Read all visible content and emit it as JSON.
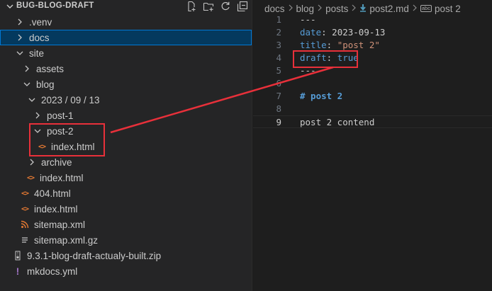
{
  "explorer": {
    "root_title": "BUG-BLOG-DRAFT",
    "tree": [
      {
        "label": ".venv",
        "type": "folder",
        "expanded": false,
        "depth": 1
      },
      {
        "label": "docs",
        "type": "folder",
        "expanded": false,
        "depth": 1,
        "selected": true
      },
      {
        "label": "site",
        "type": "folder",
        "expanded": true,
        "depth": 1
      },
      {
        "label": "assets",
        "type": "folder",
        "expanded": false,
        "depth": 2
      },
      {
        "label": "blog",
        "type": "folder",
        "expanded": true,
        "depth": 2
      },
      {
        "label": "2023 / 09 / 13",
        "type": "folder",
        "expanded": true,
        "depth": 3
      },
      {
        "label": "post-1",
        "type": "folder",
        "expanded": false,
        "depth": 4
      },
      {
        "label": "post-2",
        "type": "folder",
        "expanded": true,
        "depth": 4
      },
      {
        "label": "index.html",
        "type": "html",
        "depth": 5
      },
      {
        "label": "archive",
        "type": "folder",
        "expanded": false,
        "depth": 3
      },
      {
        "label": "index.html",
        "type": "html",
        "depth": 3
      },
      {
        "label": "404.html",
        "type": "html",
        "depth": 2
      },
      {
        "label": "index.html",
        "type": "html",
        "depth": 2
      },
      {
        "label": "sitemap.xml",
        "type": "rss",
        "depth": 2
      },
      {
        "label": "sitemap.xml.gz",
        "type": "gz",
        "depth": 2
      },
      {
        "label": "9.3.1-blog-draft-actualy-built.zip",
        "type": "zip",
        "depth": 1
      },
      {
        "label": "mkdocs.yml",
        "type": "yml",
        "depth": 1
      }
    ]
  },
  "editor": {
    "breadcrumb": {
      "part1": "docs",
      "part2": "blog",
      "part3": "posts",
      "file": "post2.md",
      "symbol": "post 2"
    },
    "lines": [
      {
        "n": "1",
        "text": "---"
      },
      {
        "n": "2",
        "key": "date",
        "value": "2023-09-13"
      },
      {
        "n": "3",
        "key": "title",
        "value": "\"post 2\""
      },
      {
        "n": "4",
        "key": "draft",
        "value": "true"
      },
      {
        "n": "5",
        "text": "---"
      },
      {
        "n": "6",
        "text": ""
      },
      {
        "n": "7",
        "heading": "# post 2"
      },
      {
        "n": "8",
        "text": ""
      },
      {
        "n": "9",
        "text": "post 2 contend",
        "current": true
      }
    ]
  },
  "colors": {
    "annotation": "#e8303a",
    "selection": "#04395e"
  }
}
